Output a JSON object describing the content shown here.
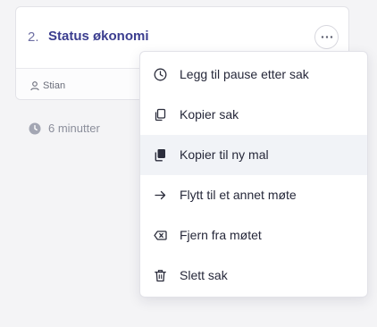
{
  "agenda_item": {
    "number": "2.",
    "title": "Status økonomi",
    "owner": "Stian",
    "duration": "6 minutter"
  },
  "icons": {
    "more": "more-horizontal-icon",
    "owner": "user-icon",
    "duration": "clock-icon"
  },
  "menu": {
    "items": [
      {
        "label": "Legg til pause etter sak",
        "icon": "clock-icon"
      },
      {
        "label": "Kopier sak",
        "icon": "copy-icon"
      },
      {
        "label": "Kopier til ny mal",
        "icon": "copy-filled-icon",
        "highlighted": true
      },
      {
        "label": "Flytt til et annet møte",
        "icon": "arrow-right-icon"
      },
      {
        "label": "Fjern fra møtet",
        "icon": "remove-tag-icon"
      },
      {
        "label": "Slett sak",
        "icon": "trash-icon"
      }
    ]
  },
  "colors": {
    "title": "#3b3d8f",
    "menu_highlight": "#f1f3f7",
    "text": "#26283a",
    "muted": "#8b8e9b"
  }
}
